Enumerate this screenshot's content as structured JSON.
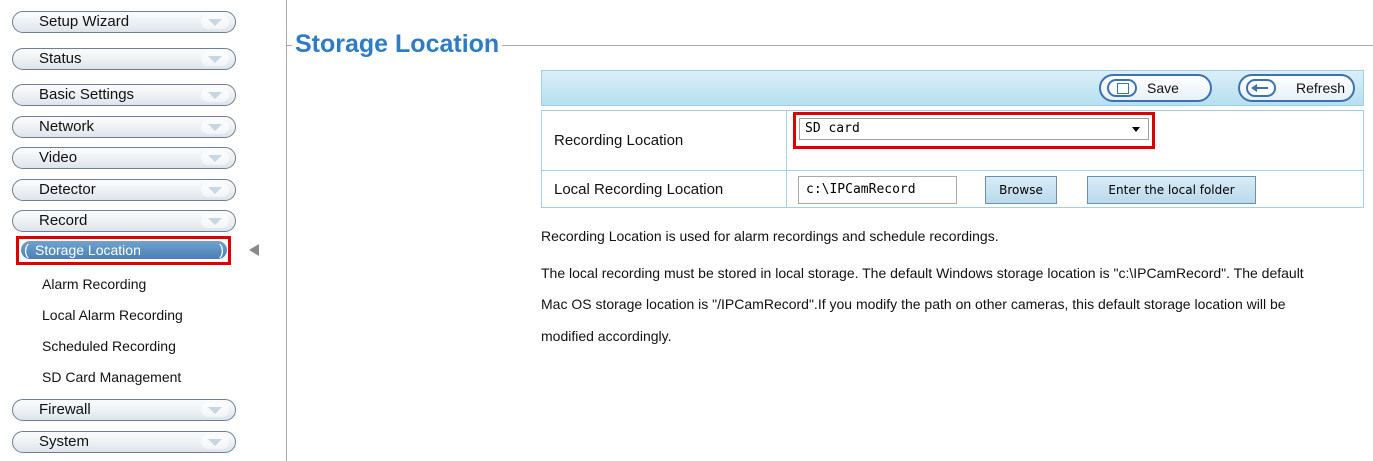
{
  "sidebar": {
    "menu": [
      {
        "label": "Setup Wizard"
      },
      {
        "label": "Status"
      },
      {
        "label": "Basic Settings"
      },
      {
        "label": "Network"
      },
      {
        "label": "Video"
      },
      {
        "label": "Detector"
      },
      {
        "label": "Record"
      }
    ],
    "record_submenu": {
      "active": "Storage Location",
      "items": [
        {
          "label": "Alarm Recording"
        },
        {
          "label": "Local Alarm Recording"
        },
        {
          "label": "Scheduled Recording"
        },
        {
          "label": "SD Card Management"
        }
      ]
    },
    "menu_bottom": [
      {
        "label": "Firewall"
      },
      {
        "label": "System"
      }
    ]
  },
  "main": {
    "title": "Storage Location",
    "toolbar": {
      "save_label": "Save",
      "refresh_label": "Refresh"
    },
    "settings": {
      "recording_location_label": "Recording Location",
      "recording_location_value": "SD card",
      "local_recording_location_label": "Local Recording Location",
      "local_path_value": "c:\\IPCamRecord",
      "browse_label": "Browse",
      "enter_folder_label": "Enter the local folder"
    },
    "description": [
      "Recording Location is used for alarm recordings and schedule recordings.",
      "The local recording must be stored in local storage. The default Windows storage location is \"c:\\IPCamRecord\". The default",
      "Mac OS storage location is \"/IPCamRecord\".If you modify the path on other cameras, this default storage location will be",
      "modified accordingly."
    ]
  },
  "colors": {
    "title_blue": "#2e7cc8",
    "highlight_red": "#e00000",
    "toolbar_blue": "#b7dff0",
    "active_item_blue": "#4a80b6"
  }
}
